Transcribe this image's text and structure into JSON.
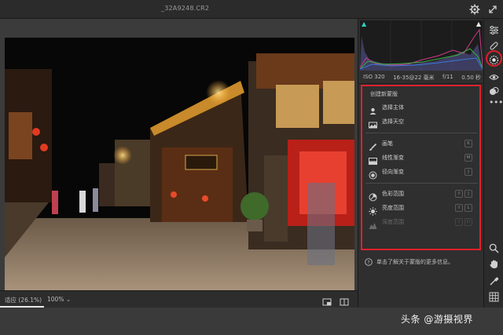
{
  "window": {
    "filename": "_32A9248.CR2"
  },
  "bottom_bar": {
    "fit_label": "适应 (26.1%)",
    "zoom_value": "100%"
  },
  "exif": {
    "iso": "ISO 320",
    "lens": "16-35@22 毫米",
    "aperture": "f/11",
    "shutter": "0.50 秒"
  },
  "mask_panel": {
    "title": "创建新蒙版",
    "items": [
      {
        "label": "选择主体",
        "icon": "person-subject-icon",
        "key": ""
      },
      {
        "label": "选择天空",
        "icon": "sky-icon",
        "key": ""
      },
      {
        "label": "画笔",
        "icon": "brush-icon",
        "key": "K"
      },
      {
        "label": "线性渐变",
        "icon": "linear-gradient-icon",
        "key": "M"
      },
      {
        "label": "径向渐变",
        "icon": "radial-gradient-icon",
        "key": "J"
      },
      {
        "label": "色彩范围",
        "icon": "color-range-icon",
        "key": "⇧J"
      },
      {
        "label": "亮度范围",
        "icon": "luminance-range-icon",
        "key": "⇧L"
      },
      {
        "label": "深度范围",
        "icon": "depth-range-icon",
        "key": "⇧D",
        "disabled": true
      }
    ],
    "help_text": "单击了解关于蒙版的更多信息。"
  },
  "watermark": "头条 @游摄视界",
  "colors": {
    "highlight": "#e0202a",
    "panel_bg": "#2f2f2f",
    "canvas_bg": "#3b3b3b"
  }
}
